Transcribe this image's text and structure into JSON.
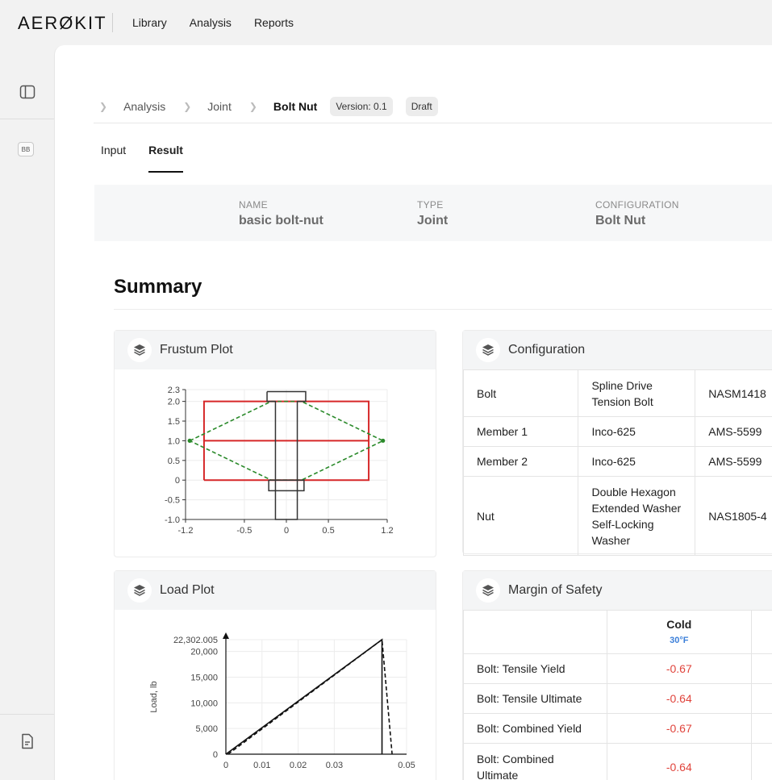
{
  "app": {
    "logo": "AERØKIT"
  },
  "topnav": [
    "Library",
    "Analysis",
    "Reports"
  ],
  "sidebar": {
    "bb_badge": "BB"
  },
  "breadcrumb": {
    "items": [
      "Analysis",
      "Joint"
    ],
    "current": "Bolt Nut",
    "version": "Version: 0.1",
    "status": "Draft"
  },
  "tabs": [
    {
      "label": "Input",
      "active": false
    },
    {
      "label": "Result",
      "active": true
    }
  ],
  "info": {
    "name_label": "NAME",
    "name_value": "basic bolt-nut",
    "type_label": "TYPE",
    "type_value": "Joint",
    "config_label": "CONFIGURATION",
    "config_value": "Bolt Nut"
  },
  "summary": {
    "title": "Summary"
  },
  "frustum": {
    "title": "Frustum Plot",
    "chart_data": {
      "type": "line",
      "xlim": [
        -1.2,
        1.2
      ],
      "ylim": [
        -1.0,
        2.3
      ],
      "xticks": [
        "-1.2",
        "-0.5",
        "0",
        "0.5",
        "1.2"
      ],
      "yticks": [
        "2.3",
        "2.0",
        "1.5",
        "1.0",
        "0.5",
        "0",
        "-0.5",
        "-1.0"
      ],
      "series": [
        {
          "color": "#d62728",
          "kind": "rect",
          "points": [
            [
              -0.98,
              0
            ],
            [
              0.98,
              0
            ],
            [
              0.98,
              2.0
            ],
            [
              -0.98,
              2.0
            ],
            [
              -0.98,
              0
            ]
          ]
        },
        {
          "color": "#d62728",
          "kind": "line",
          "points": [
            [
              -0.98,
              1.0
            ],
            [
              0.98,
              1.0
            ]
          ]
        },
        {
          "color": "#2a8a2a",
          "kind": "dashed",
          "points": [
            [
              -1.15,
              1.0
            ],
            [
              -0.18,
              2.0
            ],
            [
              0.18,
              2.0
            ],
            [
              1.15,
              1.0
            ],
            [
              0.18,
              0
            ],
            [
              -0.18,
              0
            ],
            [
              -1.15,
              1.0
            ]
          ]
        },
        {
          "color": "#333333",
          "kind": "outline",
          "points": [
            [
              -0.23,
              2.25
            ],
            [
              0.23,
              2.25
            ],
            [
              0.23,
              2.0
            ],
            [
              0.13,
              2.0
            ],
            [
              0.13,
              -1.0
            ],
            [
              -0.13,
              -1.0
            ],
            [
              -0.13,
              2.0
            ],
            [
              -0.23,
              2.0
            ],
            [
              -0.23,
              2.25
            ]
          ]
        },
        {
          "color": "#333333",
          "kind": "outline",
          "points": [
            [
              -0.21,
              0
            ],
            [
              0.21,
              0
            ],
            [
              0.21,
              -0.27
            ],
            [
              -0.21,
              -0.27
            ],
            [
              -0.21,
              0
            ]
          ]
        }
      ]
    }
  },
  "configuration": {
    "title": "Configuration",
    "rows": [
      {
        "part": "Bolt",
        "desc": "Spline Drive Tension Bolt",
        "spec": "NASM1418"
      },
      {
        "part": "Member 1",
        "desc": "Inco-625",
        "spec": "AMS-5599"
      },
      {
        "part": "Member 2",
        "desc": "Inco-625",
        "spec": "AMS-5599"
      },
      {
        "part": "Nut",
        "desc": "Double Hexagon Extended Washer Self-Locking Washer",
        "spec": "NAS1805-4"
      }
    ]
  },
  "load": {
    "title": "Load Plot",
    "chart_data": {
      "type": "line",
      "ylabel": "Load, lb",
      "xlim": [
        0,
        0.05
      ],
      "ylim": [
        0,
        22302.005
      ],
      "xticks": [
        "0",
        "0.01",
        "0.02",
        "0.03",
        "0.05"
      ],
      "yticks": [
        "22,302.005",
        "20,000",
        "15,000",
        "10,000",
        "5,000",
        "0"
      ],
      "series": [
        {
          "color": "#111111",
          "kind": "solid",
          "points": [
            [
              0,
              0
            ],
            [
              0.0432,
              22302.005
            ],
            [
              0.0432,
              0
            ]
          ]
        },
        {
          "color": "#111111",
          "kind": "dashed",
          "points": [
            [
              0.0006,
              0
            ],
            [
              0.0432,
              22302.005
            ],
            [
              0.046,
              0
            ]
          ]
        }
      ]
    }
  },
  "mos": {
    "title": "Margin of Safety",
    "col_header": "Cold",
    "col_temp": "30°F",
    "rows": [
      {
        "label": "Bolt: Tensile Yield",
        "value": "-0.67"
      },
      {
        "label": "Bolt: Tensile Ultimate",
        "value": "-0.64"
      },
      {
        "label": "Bolt: Combined Yield",
        "value": "-0.67"
      },
      {
        "label": "Bolt: Combined Ultimate",
        "value": "-0.64"
      }
    ]
  }
}
